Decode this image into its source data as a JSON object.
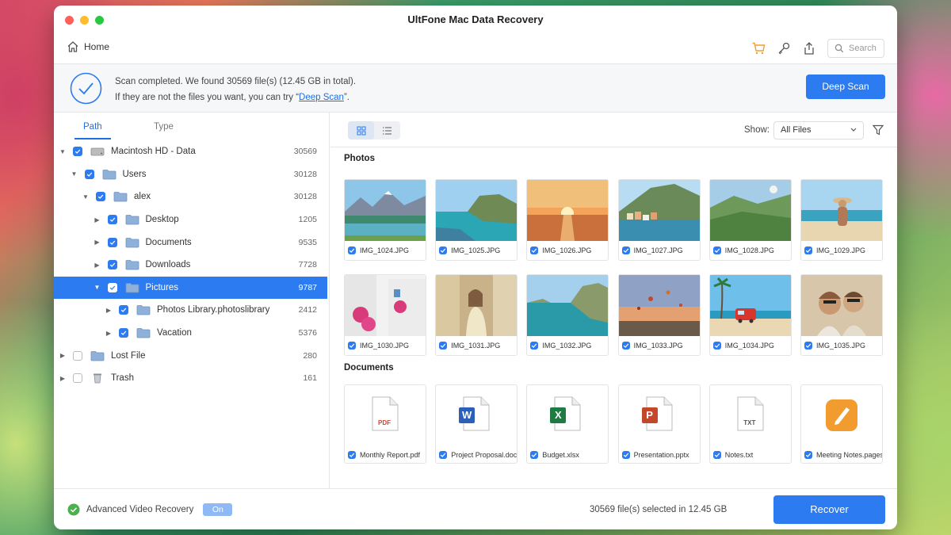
{
  "window": {
    "title": "UltFone Mac Data Recovery"
  },
  "toolbar": {
    "home_label": "Home",
    "search_placeholder": "Search",
    "icons": [
      "cart-icon",
      "key-icon",
      "share-icon",
      "search-icon"
    ]
  },
  "banner": {
    "line1": "Scan completed. We found 30569 file(s) (12.45 GB in total).",
    "line2_prefix": "If they are not the files you want, you can try “",
    "line2_link": "Deep Scan",
    "line2_suffix": "”.",
    "button": "Deep Scan"
  },
  "sidebar": {
    "tabs": [
      "Path",
      "Type"
    ],
    "active_tab": "Path",
    "tree": [
      {
        "label": "Macintosh HD - Data",
        "count": "30569",
        "arrow": "▼",
        "checked": true,
        "icon": "drive-icon"
      },
      {
        "label": "Users",
        "count": "30128",
        "arrow": "▼",
        "checked": true,
        "icon": "folder-icon"
      },
      {
        "label": "alex",
        "count": "30128",
        "arrow": "▼",
        "checked": true,
        "icon": "folder-icon"
      },
      {
        "label": "Desktop",
        "count": "1205",
        "arrow": "▶",
        "checked": true,
        "icon": "folder-icon"
      },
      {
        "label": "Documents",
        "count": "9535",
        "arrow": "▶",
        "checked": true,
        "icon": "folder-icon"
      },
      {
        "label": "Downloads",
        "count": "7728",
        "arrow": "▶",
        "checked": true,
        "icon": "folder-icon"
      },
      {
        "label": "Pictures",
        "count": "9787",
        "arrow": "▼",
        "checked": true,
        "icon": "folder-icon",
        "selected": true
      },
      {
        "label": "Photos Library.photoslibrary",
        "count": "2412",
        "arrow": "▶",
        "checked": true,
        "icon": "folder-icon"
      },
      {
        "label": "Vacation",
        "count": "5376",
        "arrow": "▶",
        "checked": true,
        "icon": "folder-icon"
      },
      {
        "label": "Lost File",
        "count": "280",
        "arrow": "▶",
        "checked": false,
        "icon": "folder-icon"
      },
      {
        "label": "Trash",
        "count": "161",
        "arrow": "▶",
        "checked": false,
        "icon": "trash-icon"
      }
    ]
  },
  "main": {
    "show_label": "Show:",
    "show_value": "All Files",
    "photos_title": "Photos",
    "documents_title": "Documents",
    "photos": [
      {
        "name": "IMG_1024.JPG",
        "scene": "lake-mountains"
      },
      {
        "name": "IMG_1025.JPG",
        "scene": "cliff-coast"
      },
      {
        "name": "IMG_1026.JPG",
        "scene": "sunset-sea"
      },
      {
        "name": "IMG_1027.JPG",
        "scene": "coastal-village"
      },
      {
        "name": "IMG_1028.JPG",
        "scene": "green-valley"
      },
      {
        "name": "IMG_1029.JPG",
        "scene": "beach-woman-hat"
      },
      {
        "name": "IMG_1030.JPG",
        "scene": "white-street-flowers"
      },
      {
        "name": "IMG_1031.JPG",
        "scene": "woman-street"
      },
      {
        "name": "IMG_1032.JPG",
        "scene": "sea-cliffs"
      },
      {
        "name": "IMG_1033.JPG",
        "scene": "hot-air-balloons"
      },
      {
        "name": "IMG_1034.JPG",
        "scene": "red-van-beach"
      },
      {
        "name": "IMG_1035.JPG",
        "scene": "couple-selfie"
      }
    ],
    "documents": [
      {
        "name": "Monthly Report.pdf",
        "icon": "pdf-icon",
        "badge": "PDF",
        "color": "#d9412e"
      },
      {
        "name": "Project Proposal.docx",
        "icon": "word-icon",
        "badge": "W",
        "color": "#2b5fb8"
      },
      {
        "name": "Budget.xlsx",
        "icon": "excel-icon",
        "badge": "X",
        "color": "#1f7a44"
      },
      {
        "name": "Presentation.pptx",
        "icon": "powerpoint-icon",
        "badge": "P",
        "color": "#c4462b"
      },
      {
        "name": "Notes.txt",
        "icon": "txt-icon",
        "badge": "TXT",
        "color": "#555555"
      },
      {
        "name": "Meeting Notes.pages",
        "icon": "pages-icon",
        "badge": "",
        "color": "#f29b2e"
      }
    ]
  },
  "footer": {
    "advanced_label": "Advanced Video Recovery",
    "toggle_label": "On",
    "selected_text": "30569 file(s) selected in 12.45 GB",
    "recover_button": "Recover"
  },
  "colors": {
    "accent": "#2c7bf0",
    "link": "#1e6fe0",
    "success": "#4caf50",
    "cart": "#f0a030"
  }
}
